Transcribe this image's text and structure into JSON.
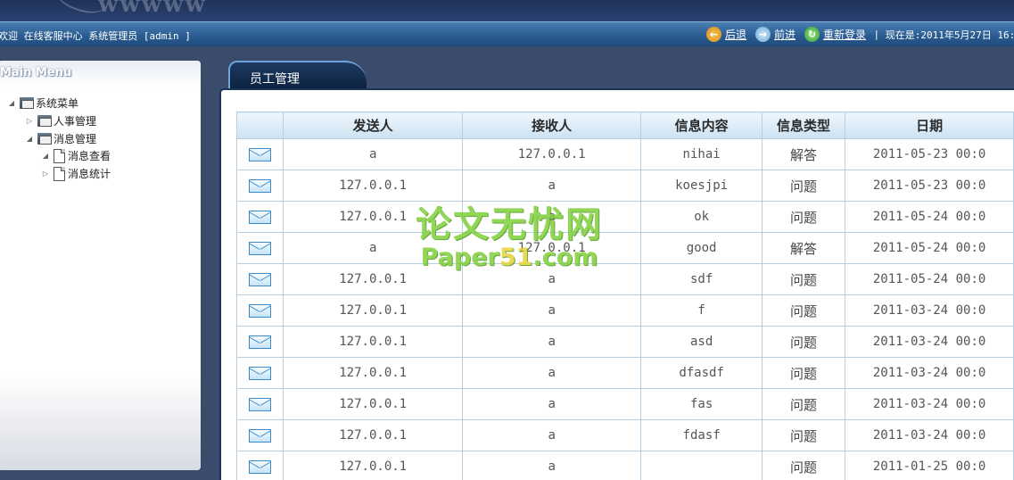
{
  "banner": {
    "logo_text": "wwwww"
  },
  "status": {
    "welcome": "欢迎 在线客服中心 系统管理员 [admin ]",
    "back_label": "后退",
    "forward_label": "前进",
    "relogin_label": "重新登录",
    "separator": "|",
    "clock": "现在是:2011年5月27日 16:"
  },
  "sidebar": {
    "title": "Main Menu",
    "tree": [
      {
        "label": "系统菜单",
        "arrow": "◢"
      },
      {
        "label": "人事管理",
        "arrow": "▷"
      },
      {
        "label": "消息管理",
        "arrow": "◢"
      },
      {
        "label": "消息查看",
        "arrow": "◢"
      },
      {
        "label": "消息统计",
        "arrow": "▷"
      }
    ]
  },
  "main": {
    "tab_label": "员工管理",
    "columns": [
      "",
      "发送人",
      "接收人",
      "信息内容",
      "信息类型",
      "日期"
    ],
    "rows": [
      {
        "sender": "a",
        "receiver": "127.0.0.1",
        "content": "nihai",
        "type": "解答",
        "date": "2011-05-23 00:0"
      },
      {
        "sender": "127.0.0.1",
        "receiver": "a",
        "content": "koesjpi",
        "type": "问题",
        "date": "2011-05-23 00:0"
      },
      {
        "sender": "127.0.0.1",
        "receiver": "a",
        "content": "ok",
        "type": "问题",
        "date": "2011-05-24 00:0"
      },
      {
        "sender": "a",
        "receiver": "127.0.0.1",
        "content": "good",
        "type": "解答",
        "date": "2011-05-24 00:0"
      },
      {
        "sender": "127.0.0.1",
        "receiver": "a",
        "content": "sdf",
        "type": "问题",
        "date": "2011-05-24 00:0"
      },
      {
        "sender": "127.0.0.1",
        "receiver": "a",
        "content": "f",
        "type": "问题",
        "date": "2011-03-24 00:0"
      },
      {
        "sender": "127.0.0.1",
        "receiver": "a",
        "content": "asd",
        "type": "问题",
        "date": "2011-03-24 00:0"
      },
      {
        "sender": "127.0.0.1",
        "receiver": "a",
        "content": "dfasdf",
        "type": "问题",
        "date": "2011-03-24 00:0"
      },
      {
        "sender": "127.0.0.1",
        "receiver": "a",
        "content": "fas",
        "type": "问题",
        "date": "2011-03-24 00:0"
      },
      {
        "sender": "127.0.0.1",
        "receiver": "a",
        "content": "fdasf",
        "type": "问题",
        "date": "2011-03-24 00:0"
      },
      {
        "sender": "127.0.0.1",
        "receiver": "a",
        "content": "",
        "type": "问题",
        "date": "2011-01-25 00:0"
      }
    ]
  },
  "watermark": {
    "line1": "论文无忧网",
    "line2_a": "Paper",
    "line2_b": "51",
    "line2_c": ".com"
  },
  "colors": {
    "header_blue": "#2b5d92",
    "tab_dark": "#0c223f",
    "grid_border": "#b6cfe3",
    "watermark_green": "#7fcf3a"
  }
}
